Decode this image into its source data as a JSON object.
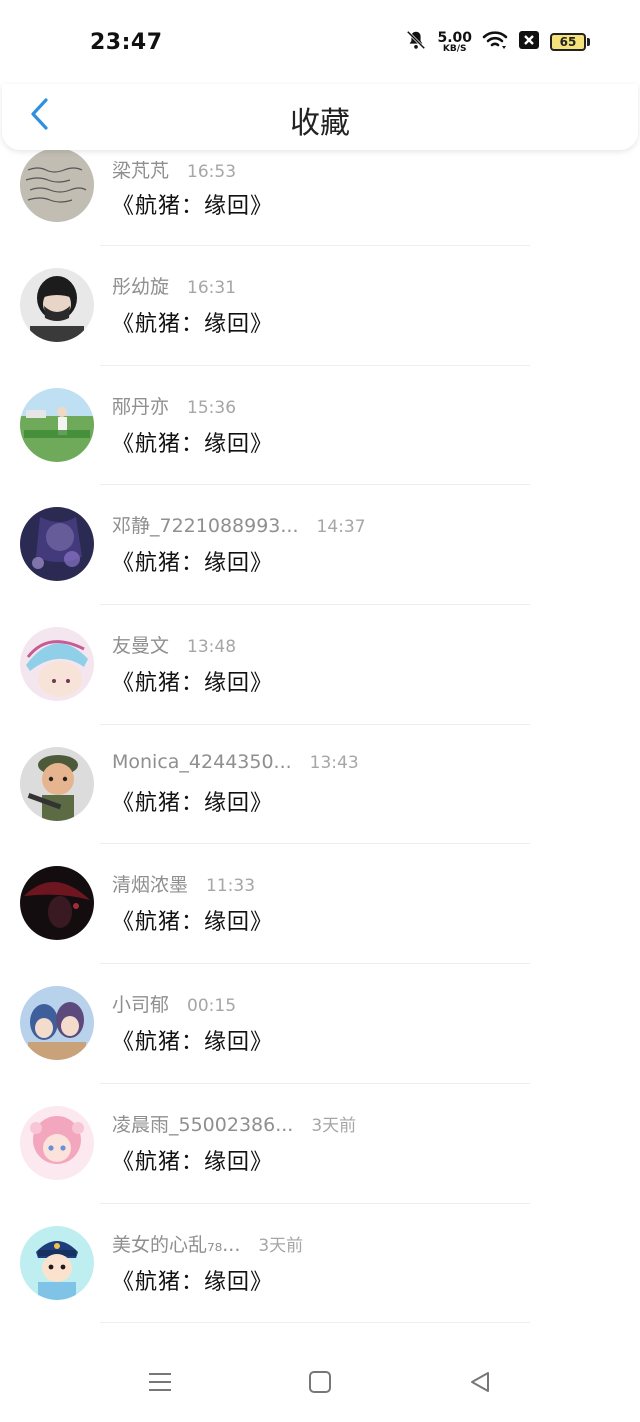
{
  "status_bar": {
    "time": "23:47",
    "net_speed_value": "5.00",
    "net_speed_unit": "KB/S",
    "battery_level": "65",
    "icons": [
      "bell-muted-icon",
      "wifi-icon",
      "close-box-icon",
      "battery-icon"
    ]
  },
  "header": {
    "title": "收藏",
    "back_icon": "chevron-left-icon",
    "accent_color": "#2f8fe0"
  },
  "items": [
    {
      "name": "梁芃芃",
      "time": "16:53",
      "title": "《航猪：缘回》",
      "avatar_icon": "avatar-handwriting"
    },
    {
      "name": "彤幼旋",
      "time": "16:31",
      "title": "《航猪：缘回》",
      "avatar_icon": "avatar-masked-person"
    },
    {
      "name": "邴丹亦",
      "time": "15:36",
      "title": "《航猪：缘回》",
      "avatar_icon": "avatar-field-scene"
    },
    {
      "name": "邓静_7221088993...",
      "time": "14:37",
      "title": "《航猪：缘回》",
      "avatar_icon": "avatar-anime-dark"
    },
    {
      "name": "友曼文",
      "time": "13:48",
      "title": "《航猪：缘回》",
      "avatar_icon": "avatar-anime-pink"
    },
    {
      "name": "Monica_4244350...",
      "time": "13:43",
      "title": "《航猪：缘回》",
      "avatar_icon": "avatar-soldier-figure"
    },
    {
      "name": "清烟浓墨",
      "time": "11:33",
      "title": "《航猪：缘回》",
      "avatar_icon": "avatar-dark-red"
    },
    {
      "name": "小司郁",
      "time": "00:15",
      "title": "《航猪：缘回》",
      "avatar_icon": "avatar-anime-pair"
    },
    {
      "name": "凌晨雨_55002386...",
      "time": "3天前",
      "title": "《航猪：缘回》",
      "avatar_icon": "avatar-anime-pink-hair"
    },
    {
      "name": "美女的心乱₇₈...",
      "time": "3天前",
      "title": "《航猪：缘回》",
      "avatar_icon": "avatar-police-cartoon"
    }
  ],
  "nav": {
    "icons": [
      "menu-icon",
      "home-square-icon",
      "back-triangle-icon"
    ]
  }
}
